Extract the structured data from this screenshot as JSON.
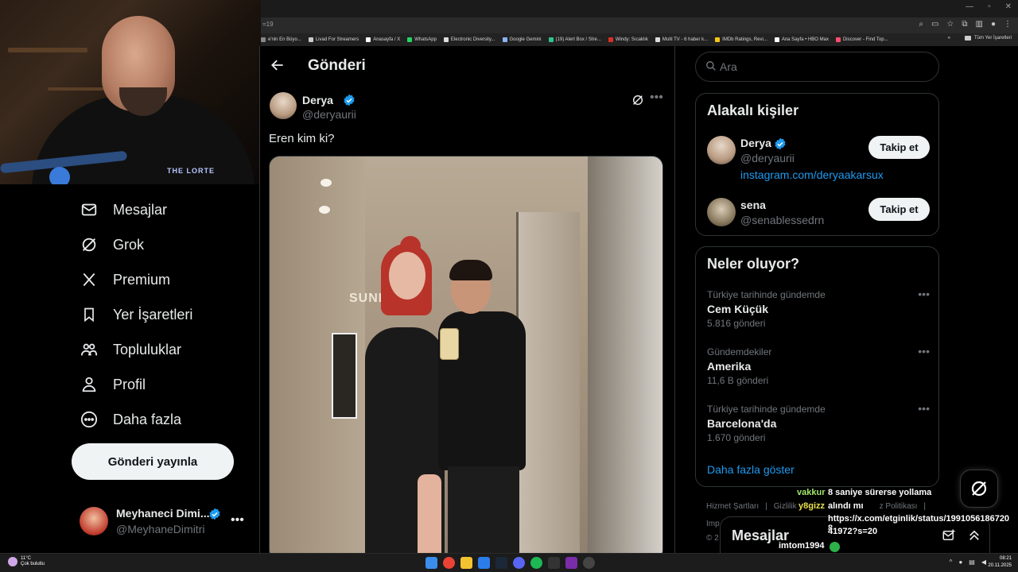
{
  "browser": {
    "url_fragment": "=19",
    "bookmarks": [
      {
        "label": "e'nin En Büyo...",
        "color": "#888888"
      },
      {
        "label": "Livad For Streamers",
        "color": "#cccccc"
      },
      {
        "label": "Anasayfa / X",
        "color": "#ffffff"
      },
      {
        "label": "WhatsApp",
        "color": "#25d366"
      },
      {
        "label": "Electronic Diversity...",
        "color": "#dddddd"
      },
      {
        "label": "Google Gemini",
        "color": "#8ab4f8"
      },
      {
        "label": "(19) Alert Box / Stre...",
        "color": "#31c48d"
      },
      {
        "label": "Windy: Sıcaklık",
        "color": "#d93025"
      },
      {
        "label": "Multi TV - 6 haber k...",
        "color": "#dddddd"
      },
      {
        "label": "IMDb Ratings, Revi...",
        "color": "#f5c518"
      },
      {
        "label": "Ana Sayfa • HBO Max",
        "color": "#ffffff"
      },
      {
        "label": "Discover - Find Top...",
        "color": "#ff4d6d"
      }
    ],
    "bookmarks_more": "»",
    "all_bookmarks": "Tüm Yer İşaretleri"
  },
  "webcam": {
    "logo_text": "THE LORTE"
  },
  "sidebar": {
    "items": [
      {
        "label": "Mesajlar",
        "icon": "envelope-icon"
      },
      {
        "label": "Grok",
        "icon": "grok-icon"
      },
      {
        "label": "Premium",
        "icon": "x-logo-icon"
      },
      {
        "label": "Yer İşaretleri",
        "icon": "bookmark-icon"
      },
      {
        "label": "Topluluklar",
        "icon": "communities-icon"
      },
      {
        "label": "Profil",
        "icon": "profile-icon"
      },
      {
        "label": "Daha fazla",
        "icon": "more-circle-icon"
      }
    ],
    "post_button": "Gönderi yayınla",
    "account": {
      "name": "Meyhaneci Dimi...",
      "handle": "@MeyhaneDimitri",
      "more": "•••"
    }
  },
  "main": {
    "title": "Gönderi",
    "post": {
      "author": "Derya",
      "handle": "@deryaurii",
      "text": "Eren kim ki?",
      "more": "•••"
    },
    "photo_sign": "SUNI"
  },
  "right": {
    "search_placeholder": "Ara",
    "related": {
      "title": "Alakalı kişiler",
      "people": [
        {
          "name": "Derya",
          "verified": true,
          "handle": "@deryaurii",
          "link": "instagram.com/deryaakarsux",
          "button": "Takip et"
        },
        {
          "name": "sena",
          "verified": false,
          "handle": "@senablessedrn",
          "link": "",
          "button": "Takip et"
        }
      ]
    },
    "trends": {
      "title": "Neler oluyor?",
      "items": [
        {
          "context": "Türkiye tarihinde gündemde",
          "topic": "Cem Küçük",
          "count": "5.816 gönderi"
        },
        {
          "context": "Gündemdekiler",
          "topic": "Amerika",
          "count": "11,6 B gönderi"
        },
        {
          "context": "Türkiye tarihinde gündemde",
          "topic": "Barcelona'da",
          "count": "1.670 gönderi"
        }
      ],
      "show_more": "Daha fazla göster",
      "more": "•••"
    },
    "footer": {
      "terms": "Hizmet Şartları",
      "privacy": "Gizlilik",
      "cookie": "z Politikası",
      "sep": "|",
      "imp": "Imp",
      "copy": "© 2"
    }
  },
  "messages_drawer": {
    "title": "Mesajlar"
  },
  "chat": {
    "lines": [
      {
        "user": "vakkur",
        "msg": "8 saniye sürerse yollama"
      },
      {
        "user": "y8gizz",
        "msg": "alındı mı"
      },
      {
        "user": "",
        "msg": "https://x.com/etginlik/status/1991056186720 8"
      },
      {
        "user": "",
        "msg": "41972?s=20"
      },
      {
        "user": "imtom1994",
        "msg": ""
      },
      {
        "user": "imtom1994",
        "msg": ""
      }
    ]
  },
  "taskbar": {
    "weather_temp": "11°C",
    "weather_desc": "Çok bulutlu",
    "time": "08:21",
    "date": "20.11.2025"
  },
  "colors": {
    "accent": "#1d9bf0",
    "verified": "#1d9bf0",
    "bg": "#000000",
    "border": "#2f3336"
  }
}
